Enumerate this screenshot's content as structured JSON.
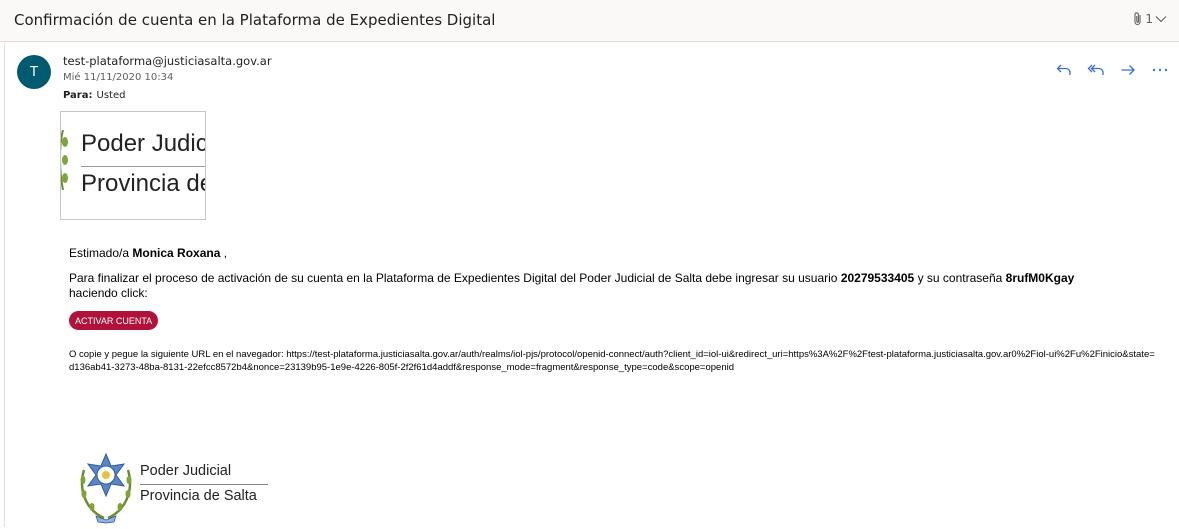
{
  "email": {
    "subject": "Confirmación de cuenta en la Plataforma de Expedientes Digital",
    "attachment_count": "1",
    "attachment_icon": "paperclip-icon",
    "sender": {
      "avatar_initial": "T",
      "avatar_color": "#005b70",
      "address": "test-plataforma@justiciasalta.gov.ar",
      "date": "Mié 11/11/2020 10:34",
      "to_label": "Para:",
      "to_value": "Usted"
    },
    "actions": [
      "reply-icon",
      "reply-all-icon",
      "forward-icon",
      "more-icon"
    ]
  },
  "body": {
    "logo_line1": "Poder Judic",
    "logo_line2": "Provincia de",
    "greeting_prefix": "Estimado/a",
    "greeting_name": "Monica Roxana",
    "greeting_suffix": ",",
    "message_part1": "Para finalizar el proceso de activación de su cuenta en la Plataforma de Expedientes Digital del Poder Judicial de Salta debe ingresar su usuario",
    "username": "20279533405",
    "message_part2": "y su contraseña",
    "password": "8rufM0Kgay",
    "message_part3": "haciendo click:",
    "button_label": "ACTIVAR CUENTA",
    "button_color": "#b0123b",
    "url_prefix": "O copie y pegue la siguiente URL en el navegador:",
    "url": "https://test-plataforma.justiciasalta.gov.ar/auth/realms/iol-pjs/protocol/openid-connect/auth?client_id=iol-ui&redirect_uri=https%3A%2F%2Ftest-plataforma.justiciasalta.gov.ar0%2Fiol-ui%2Fu%2Finicio&state=d136ab41-3273-48ba-8131-22efcc8572b4&nonce=23139b95-1e9e-4226-805f-2f2f61d4addf&response_mode=fragment&response_type=code&scope=openid",
    "footer_line1": "Poder Judicial",
    "footer_line2": "Provincia de Salta"
  }
}
